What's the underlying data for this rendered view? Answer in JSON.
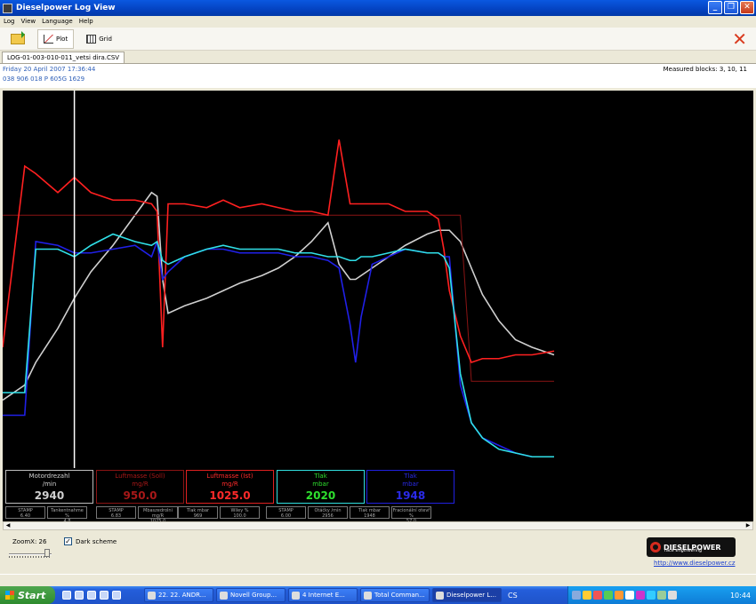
{
  "window": {
    "title": "Dieselpower Log View"
  },
  "menu": [
    "Log",
    "View",
    "Language",
    "Help"
  ],
  "toolbar": {
    "plot_label": "Plot",
    "grid_label": "Grid"
  },
  "file_tab": "LOG-01-003-010-011_vetsi dira.CSV",
  "info": {
    "date": "Friday 20 April 2007 17:36:44",
    "ecu": "038 906 018 P  605G  1629",
    "measured_blocks": "Measured blocks: 3, 10, 11"
  },
  "value_boxes": [
    {
      "title": "Motordrezahl",
      "unit": "/min",
      "value": "2940",
      "color": "#bdbdbd",
      "text_color": "#d0d0d0"
    },
    {
      "title": "Luftmasse (Soll)",
      "unit": "mg/R",
      "value": "950.0",
      "color": "#8a1414",
      "text_color": "#a81818"
    },
    {
      "title": "Luftmasse (Ist)",
      "unit": "mg/R",
      "value": "1025.0",
      "color": "#e02020",
      "text_color": "#ff2a2a"
    },
    {
      "title": "Tlak",
      "unit": "mbar",
      "value": "2020",
      "color": "#30e0e0",
      "text_color": "#2ee02e"
    },
    {
      "title": "Tlak",
      "unit": "mbar",
      "value": "1948",
      "color": "#2020e0",
      "text_color": "#2a2ae8"
    }
  ],
  "small_boxes": [
    {
      "label": "STAMP",
      "value": "6.40"
    },
    {
      "label": "Tankentnahme %",
      "value": "4.8"
    },
    {
      "label": "STAMP",
      "value": "6.83"
    },
    {
      "label": "Mbaszedrolni mg/R",
      "value": "1025.0"
    },
    {
      "label": "Tlak mbar",
      "value": "969"
    },
    {
      "label": "Wiley %",
      "value": "100.0"
    },
    {
      "label": "STAMP",
      "value": "6.00"
    },
    {
      "label": "Otáčky /min",
      "value": "2956"
    },
    {
      "label": "Tlak mbar",
      "value": "1948"
    },
    {
      "label": "Fracionální otevř %",
      "value": "57.0"
    }
  ],
  "chart_data": {
    "type": "line",
    "x": [
      0,
      4,
      6,
      10,
      13,
      16,
      20,
      24,
      27,
      28,
      29,
      30,
      33,
      37,
      40,
      43,
      47,
      50,
      53,
      56,
      59,
      61,
      63,
      64,
      65,
      67,
      70,
      73,
      77,
      79,
      80,
      81,
      83,
      85,
      87,
      90,
      93,
      96,
      100
    ],
    "series": [
      {
        "color": "#d0d0d0",
        "values": [
          8,
          12,
          18,
          27,
          35,
          42,
          49,
          57,
          63,
          62,
          40,
          31,
          33,
          35,
          37,
          39,
          41,
          43,
          46,
          50,
          55,
          44,
          40,
          40,
          41,
          43,
          46,
          49,
          52,
          53,
          53,
          53,
          50,
          43,
          36,
          29,
          24,
          22,
          20
        ]
      },
      {
        "color": "#8a1414",
        "values": [
          57,
          57,
          57,
          57,
          57,
          57,
          57,
          57,
          57,
          57,
          57,
          57,
          57,
          57,
          57,
          57,
          57,
          57,
          57,
          57,
          57,
          57,
          57,
          57,
          57,
          57,
          57,
          57,
          57,
          57,
          57,
          57,
          57,
          13,
          13,
          13,
          13,
          13,
          13
        ]
      },
      {
        "color": "#ff2020",
        "values": [
          22,
          70,
          68,
          63,
          67,
          63,
          61,
          61,
          60,
          58,
          22,
          60,
          60,
          59,
          61,
          59,
          60,
          59,
          58,
          58,
          57,
          77,
          60,
          60,
          60,
          60,
          60,
          58,
          58,
          56,
          48,
          37,
          25,
          18,
          19,
          19,
          20,
          20,
          21
        ]
      },
      {
        "color": "#2020e8",
        "values": [
          4,
          4,
          50,
          49,
          47,
          47,
          48,
          49,
          46,
          50,
          40,
          42,
          46,
          48,
          48,
          47,
          47,
          47,
          46,
          46,
          45,
          43,
          28,
          18,
          30,
          44,
          46,
          48,
          47,
          47,
          46,
          46,
          12,
          2,
          -2,
          -4,
          -6,
          -7,
          -7
        ]
      },
      {
        "color": "#30e0e8",
        "values": [
          10,
          10,
          48,
          48,
          46,
          49,
          52,
          50,
          49,
          50,
          45,
          44,
          46,
          48,
          49,
          48,
          48,
          48,
          47,
          47,
          46,
          46,
          45,
          45,
          46,
          46,
          47,
          48,
          47,
          47,
          46,
          43,
          15,
          2,
          -2,
          -5,
          -6,
          -7,
          -7
        ]
      }
    ],
    "cursor_x": 13,
    "ylim": [
      -10,
      90
    ],
    "grid": false
  },
  "controls": {
    "zoom_label": "ZoomX: 26",
    "zoom_level": 26,
    "dark_scheme_label": "Dark scheme",
    "dark_scheme_checked": "✓"
  },
  "logo": {
    "name": "DIESELPOWER",
    "tagline": "race engineering",
    "url": "http://www.dieselpower.cz"
  },
  "taskbar": {
    "start": "Start",
    "tasks": [
      {
        "label": "22. 22. ANDR..."
      },
      {
        "label": "Novell Group..."
      },
      {
        "label": "4 Internet E..."
      },
      {
        "label": "Total Comman..."
      },
      {
        "label": "Dieselpower L..."
      }
    ],
    "lang": "CS",
    "clock": "10:44"
  }
}
